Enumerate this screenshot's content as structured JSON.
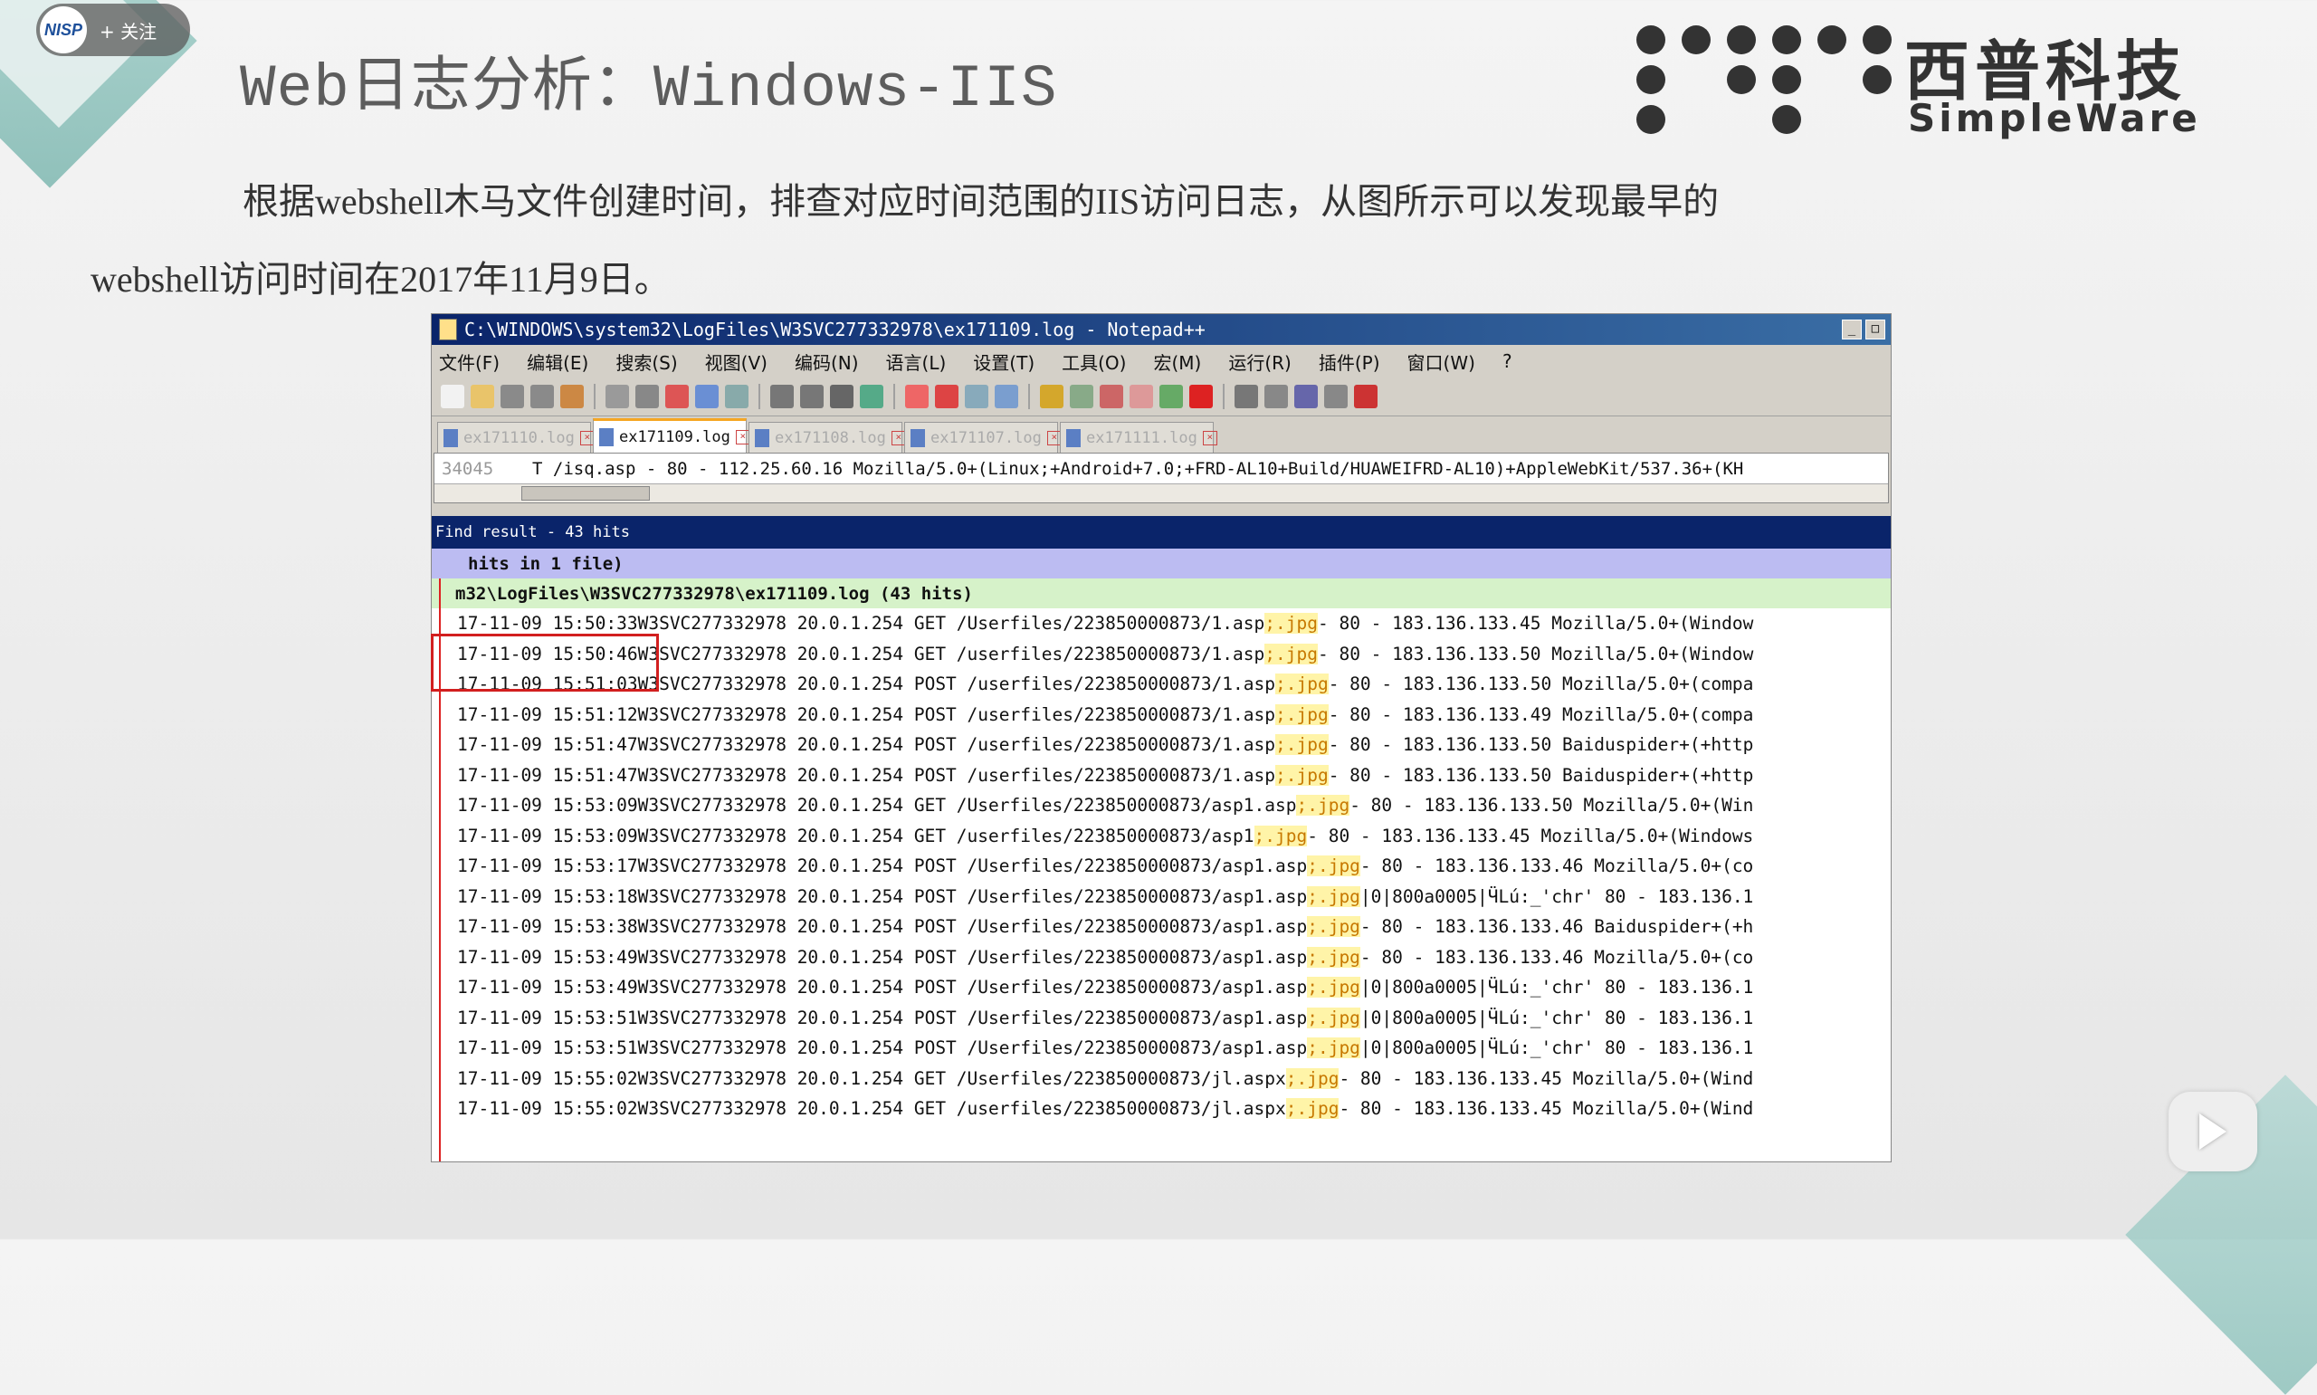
{
  "follow_pill": {
    "avatar_text": "NISP",
    "label": "+ 关注"
  },
  "slide": {
    "title": "Web日志分析：Windows-IIS",
    "logo_cn": "西普科技",
    "logo_en": "SimpleWare",
    "paragraph_line1": "根据webshell木马文件创建时间，排查对应时间范围的IIS访问日志，从图所示可以发现最早的",
    "paragraph_line2": "webshell访问时间在2017年11月9日。"
  },
  "window": {
    "title": "C:\\WINDOWS\\system32\\LogFiles\\W3SVC277332978\\ex171109.log - Notepad++",
    "minimize": "_",
    "maximize": "□",
    "menu": [
      "文件(F)",
      "编辑(E)",
      "搜索(S)",
      "视图(V)",
      "编码(N)",
      "语言(L)",
      "设置(T)",
      "工具(O)",
      "宏(M)",
      "运行(R)",
      "插件(P)",
      "窗口(W)",
      "?"
    ],
    "tabs": [
      {
        "label": "ex171110.log",
        "active": false
      },
      {
        "label": "ex171109.log",
        "active": true
      },
      {
        "label": "ex171108.log",
        "active": false
      },
      {
        "label": "ex171107.log",
        "active": false
      },
      {
        "label": "ex171111.log",
        "active": false
      }
    ],
    "editor": {
      "line_number": "34045",
      "line_text": "T /isq.asp - 80 - 112.25.60.16 Mozilla/5.0+(Linux;+Android+7.0;+FRD-AL10+Build/HUAWEIFRD-AL10)+AppleWebKit/537.36+(KH"
    },
    "find_result": "Find result - 43 hits",
    "hits_line": "hits in 1 file)",
    "file_line": "m32\\LogFiles\\W3SVC277332978\\ex171109.log (43 hits)",
    "log_rows": [
      {
        "time": "17-11-09 15:50:33",
        "pre": " W3SVC277332978 20.0.1.254 GET /Userfiles/223850000873/1.asp",
        "hl": ";.jpg",
        "post": " - 80 - 183.136.133.45 Mozilla/5.0+(Window"
      },
      {
        "time": "17-11-09 15:50:46",
        "pre": " W3SVC277332978 20.0.1.254 GET /userfiles/223850000873/1.asp",
        "hl": ";.jpg",
        "post": " - 80 - 183.136.133.50 Mozilla/5.0+(Window"
      },
      {
        "time": "17-11-09 15:51:03",
        "pre": " W3SVC277332978 20.0.1.254 POST /userfiles/223850000873/1.asp",
        "hl": ";.jpg",
        "post": " - 80 - 183.136.133.50 Mozilla/5.0+(compa"
      },
      {
        "time": "17-11-09 15:51:12",
        "pre": " W3SVC277332978 20.0.1.254 POST /userfiles/223850000873/1.asp",
        "hl": ";.jpg",
        "post": " - 80 - 183.136.133.49 Mozilla/5.0+(compa"
      },
      {
        "time": "17-11-09 15:51:47",
        "pre": " W3SVC277332978 20.0.1.254 POST /userfiles/223850000873/1.asp",
        "hl": ";.jpg",
        "post": " - 80 - 183.136.133.50 Baiduspider+(+http"
      },
      {
        "time": "17-11-09 15:51:47",
        "pre": " W3SVC277332978 20.0.1.254 POST /userfiles/223850000873/1.asp",
        "hl": ";.jpg",
        "post": " - 80 - 183.136.133.50 Baiduspider+(+http"
      },
      {
        "time": "17-11-09 15:53:09",
        "pre": " W3SVC277332978 20.0.1.254 GET /Userfiles/223850000873/asp1.asp",
        "hl": ";.jpg",
        "post": " - 80 - 183.136.133.50 Mozilla/5.0+(Win"
      },
      {
        "time": "17-11-09 15:53:09",
        "pre": " W3SVC277332978 20.0.1.254 GET /userfiles/223850000873/asp1",
        "hl": ";.jpg",
        "post": " - 80 - 183.136.133.45 Mozilla/5.0+(Windows"
      },
      {
        "time": "17-11-09 15:53:17",
        "pre": " W3SVC277332978 20.0.1.254 POST /Userfiles/223850000873/asp1.asp",
        "hl": ";.jpg",
        "post": " - 80 - 183.136.133.46 Mozilla/5.0+(co"
      },
      {
        "time": "17-11-09 15:53:18",
        "pre": " W3SVC277332978 20.0.1.254 POST /Userfiles/223850000873/asp1.asp",
        "hl": ";.jpg",
        "post": " |0|800a0005|ӴLú:_'chr' 80 - 183.136.1"
      },
      {
        "time": "17-11-09 15:53:38",
        "pre": " W3SVC277332978 20.0.1.254 POST /Userfiles/223850000873/asp1.asp",
        "hl": ";.jpg",
        "post": " - 80 - 183.136.133.46 Baiduspider+(+h"
      },
      {
        "time": "17-11-09 15:53:49",
        "pre": " W3SVC277332978 20.0.1.254 POST /Userfiles/223850000873/asp1.asp",
        "hl": ";.jpg",
        "post": " - 80 - 183.136.133.46 Mozilla/5.0+(co"
      },
      {
        "time": "17-11-09 15:53:49",
        "pre": " W3SVC277332978 20.0.1.254 POST /Userfiles/223850000873/asp1.asp",
        "hl": ";.jpg",
        "post": " |0|800a0005|ӴLú:_'chr' 80 - 183.136.1"
      },
      {
        "time": "17-11-09 15:53:51",
        "pre": " W3SVC277332978 20.0.1.254 POST /Userfiles/223850000873/asp1.asp",
        "hl": ";.jpg",
        "post": " |0|800a0005|ӴLú:_'chr' 80 - 183.136.1"
      },
      {
        "time": "17-11-09 15:53:51",
        "pre": " W3SVC277332978 20.0.1.254 POST /Userfiles/223850000873/asp1.asp",
        "hl": ";.jpg",
        "post": " |0|800a0005|ӴLú:_'chr' 80 - 183.136.1"
      },
      {
        "time": "17-11-09 15:55:02",
        "pre": " W3SVC277332978 20.0.1.254 GET /Userfiles/223850000873/jl.aspx",
        "hl": ";.jpg",
        "post": " - 80 - 183.136.133.45 Mozilla/5.0+(Wind"
      },
      {
        "time": "17-11-09 15:55:02",
        "pre": " W3SVC277332978 20.0.1.254 GET /userfiles/223850000873/jl.aspx",
        "hl": ";.jpg",
        "post": " - 80 - 183.136.133.45 Mozilla/5.0+(Wind"
      }
    ]
  },
  "colors": {
    "highlight_box": "#d21f1f",
    "find_bar": "#0a246a",
    "hits_row": "#bcbcf2",
    "file_row": "#d6f2c9"
  },
  "icons": [
    "nisp-avatar-icon",
    "video-play-icon",
    "notepadpp-app-icon",
    "file-tab-icon",
    "tab-close-icon"
  ]
}
